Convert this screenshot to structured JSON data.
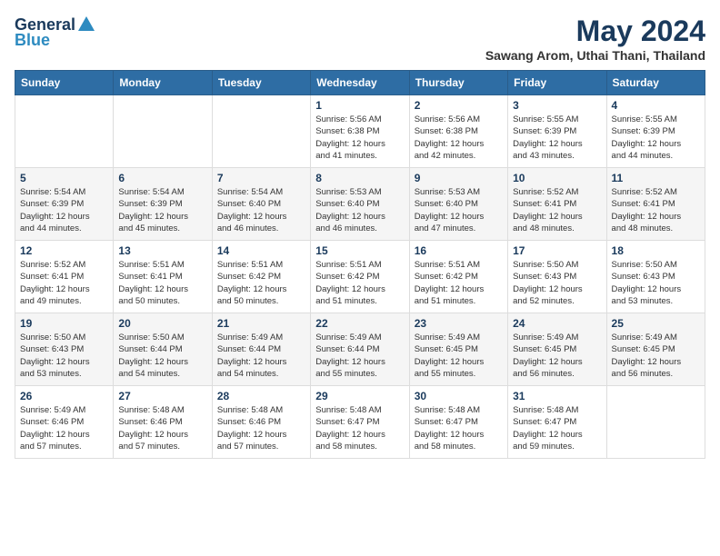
{
  "logo": {
    "general": "General",
    "blue": "Blue"
  },
  "title": "May 2024",
  "subtitle": "Sawang Arom, Uthai Thani, Thailand",
  "days_of_week": [
    "Sunday",
    "Monday",
    "Tuesday",
    "Wednesday",
    "Thursday",
    "Friday",
    "Saturday"
  ],
  "weeks": [
    [
      {
        "day": "",
        "info": ""
      },
      {
        "day": "",
        "info": ""
      },
      {
        "day": "",
        "info": ""
      },
      {
        "day": "1",
        "info": "Sunrise: 5:56 AM\nSunset: 6:38 PM\nDaylight: 12 hours\nand 41 minutes."
      },
      {
        "day": "2",
        "info": "Sunrise: 5:56 AM\nSunset: 6:38 PM\nDaylight: 12 hours\nand 42 minutes."
      },
      {
        "day": "3",
        "info": "Sunrise: 5:55 AM\nSunset: 6:39 PM\nDaylight: 12 hours\nand 43 minutes."
      },
      {
        "day": "4",
        "info": "Sunrise: 5:55 AM\nSunset: 6:39 PM\nDaylight: 12 hours\nand 44 minutes."
      }
    ],
    [
      {
        "day": "5",
        "info": "Sunrise: 5:54 AM\nSunset: 6:39 PM\nDaylight: 12 hours\nand 44 minutes."
      },
      {
        "day": "6",
        "info": "Sunrise: 5:54 AM\nSunset: 6:39 PM\nDaylight: 12 hours\nand 45 minutes."
      },
      {
        "day": "7",
        "info": "Sunrise: 5:54 AM\nSunset: 6:40 PM\nDaylight: 12 hours\nand 46 minutes."
      },
      {
        "day": "8",
        "info": "Sunrise: 5:53 AM\nSunset: 6:40 PM\nDaylight: 12 hours\nand 46 minutes."
      },
      {
        "day": "9",
        "info": "Sunrise: 5:53 AM\nSunset: 6:40 PM\nDaylight: 12 hours\nand 47 minutes."
      },
      {
        "day": "10",
        "info": "Sunrise: 5:52 AM\nSunset: 6:41 PM\nDaylight: 12 hours\nand 48 minutes."
      },
      {
        "day": "11",
        "info": "Sunrise: 5:52 AM\nSunset: 6:41 PM\nDaylight: 12 hours\nand 48 minutes."
      }
    ],
    [
      {
        "day": "12",
        "info": "Sunrise: 5:52 AM\nSunset: 6:41 PM\nDaylight: 12 hours\nand 49 minutes."
      },
      {
        "day": "13",
        "info": "Sunrise: 5:51 AM\nSunset: 6:41 PM\nDaylight: 12 hours\nand 50 minutes."
      },
      {
        "day": "14",
        "info": "Sunrise: 5:51 AM\nSunset: 6:42 PM\nDaylight: 12 hours\nand 50 minutes."
      },
      {
        "day": "15",
        "info": "Sunrise: 5:51 AM\nSunset: 6:42 PM\nDaylight: 12 hours\nand 51 minutes."
      },
      {
        "day": "16",
        "info": "Sunrise: 5:51 AM\nSunset: 6:42 PM\nDaylight: 12 hours\nand 51 minutes."
      },
      {
        "day": "17",
        "info": "Sunrise: 5:50 AM\nSunset: 6:43 PM\nDaylight: 12 hours\nand 52 minutes."
      },
      {
        "day": "18",
        "info": "Sunrise: 5:50 AM\nSunset: 6:43 PM\nDaylight: 12 hours\nand 53 minutes."
      }
    ],
    [
      {
        "day": "19",
        "info": "Sunrise: 5:50 AM\nSunset: 6:43 PM\nDaylight: 12 hours\nand 53 minutes."
      },
      {
        "day": "20",
        "info": "Sunrise: 5:50 AM\nSunset: 6:44 PM\nDaylight: 12 hours\nand 54 minutes."
      },
      {
        "day": "21",
        "info": "Sunrise: 5:49 AM\nSunset: 6:44 PM\nDaylight: 12 hours\nand 54 minutes."
      },
      {
        "day": "22",
        "info": "Sunrise: 5:49 AM\nSunset: 6:44 PM\nDaylight: 12 hours\nand 55 minutes."
      },
      {
        "day": "23",
        "info": "Sunrise: 5:49 AM\nSunset: 6:45 PM\nDaylight: 12 hours\nand 55 minutes."
      },
      {
        "day": "24",
        "info": "Sunrise: 5:49 AM\nSunset: 6:45 PM\nDaylight: 12 hours\nand 56 minutes."
      },
      {
        "day": "25",
        "info": "Sunrise: 5:49 AM\nSunset: 6:45 PM\nDaylight: 12 hours\nand 56 minutes."
      }
    ],
    [
      {
        "day": "26",
        "info": "Sunrise: 5:49 AM\nSunset: 6:46 PM\nDaylight: 12 hours\nand 57 minutes."
      },
      {
        "day": "27",
        "info": "Sunrise: 5:48 AM\nSunset: 6:46 PM\nDaylight: 12 hours\nand 57 minutes."
      },
      {
        "day": "28",
        "info": "Sunrise: 5:48 AM\nSunset: 6:46 PM\nDaylight: 12 hours\nand 57 minutes."
      },
      {
        "day": "29",
        "info": "Sunrise: 5:48 AM\nSunset: 6:47 PM\nDaylight: 12 hours\nand 58 minutes."
      },
      {
        "day": "30",
        "info": "Sunrise: 5:48 AM\nSunset: 6:47 PM\nDaylight: 12 hours\nand 58 minutes."
      },
      {
        "day": "31",
        "info": "Sunrise: 5:48 AM\nSunset: 6:47 PM\nDaylight: 12 hours\nand 59 minutes."
      },
      {
        "day": "",
        "info": ""
      }
    ]
  ]
}
